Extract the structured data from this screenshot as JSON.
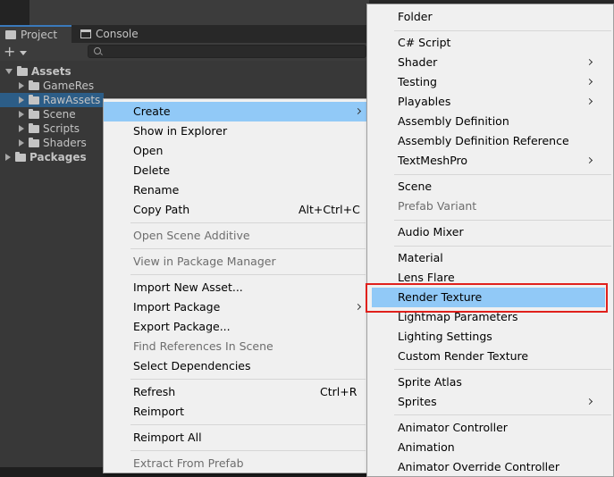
{
  "tabs": [
    {
      "label": "Project",
      "icon": "folder-icon",
      "active": true
    },
    {
      "label": "Console",
      "icon": "console-icon",
      "active": false
    }
  ],
  "toolbar": {
    "add_label": "+",
    "search_placeholder": ""
  },
  "tree": [
    {
      "label": "Assets",
      "expanded": true,
      "bold": true
    },
    {
      "label": "GameRes",
      "expanded": false,
      "bold": false
    },
    {
      "label": "RawAssets",
      "expanded": false,
      "bold": false,
      "selected": true
    },
    {
      "label": "Scene",
      "expanded": false,
      "bold": false
    },
    {
      "label": "Scripts",
      "expanded": false,
      "bold": false
    },
    {
      "label": "Shaders",
      "expanded": false,
      "bold": false
    },
    {
      "label": "Packages",
      "expanded": false,
      "bold": true
    }
  ],
  "context_menu": {
    "items": [
      {
        "label": "Create",
        "submenu": true,
        "highlighted": true
      },
      {
        "label": "Show in Explorer"
      },
      {
        "label": "Open"
      },
      {
        "label": "Delete"
      },
      {
        "label": "Rename"
      },
      {
        "label": "Copy Path",
        "shortcut": "Alt+Ctrl+C"
      },
      {
        "label": "Open Scene Additive",
        "disabled": true
      },
      {
        "label": "View in Package Manager",
        "disabled": true
      },
      {
        "label": "Import New Asset..."
      },
      {
        "label": "Import Package",
        "submenu": true
      },
      {
        "label": "Export Package..."
      },
      {
        "label": "Find References In Scene",
        "disabled": true
      },
      {
        "label": "Select Dependencies"
      },
      {
        "label": "Refresh",
        "shortcut": "Ctrl+R"
      },
      {
        "label": "Reimport"
      },
      {
        "label": "Reimport All"
      },
      {
        "label": "Extract From Prefab",
        "disabled": true
      }
    ]
  },
  "create_submenu": {
    "items": [
      {
        "label": "Folder"
      },
      {
        "label": "C# Script"
      },
      {
        "label": "Shader",
        "submenu": true
      },
      {
        "label": "Testing",
        "submenu": true
      },
      {
        "label": "Playables",
        "submenu": true
      },
      {
        "label": "Assembly Definition"
      },
      {
        "label": "Assembly Definition Reference"
      },
      {
        "label": "TextMeshPro",
        "submenu": true
      },
      {
        "label": "Scene"
      },
      {
        "label": "Prefab Variant",
        "disabled": true
      },
      {
        "label": "Audio Mixer"
      },
      {
        "label": "Material"
      },
      {
        "label": "Lens Flare"
      },
      {
        "label": "Render Texture",
        "highlighted": true
      },
      {
        "label": "Lightmap Parameters"
      },
      {
        "label": "Lighting Settings"
      },
      {
        "label": "Custom Render Texture"
      },
      {
        "label": "Sprite Atlas"
      },
      {
        "label": "Sprites",
        "submenu": true
      },
      {
        "label": "Animator Controller"
      },
      {
        "label": "Animation"
      },
      {
        "label": "Animator Override Controller"
      }
    ]
  },
  "colors": {
    "menu_bg": "#f0f0f0",
    "menu_highlight": "#91c9f7",
    "tree_selection": "#2c5d87",
    "focus_outline": "#e0201c"
  }
}
